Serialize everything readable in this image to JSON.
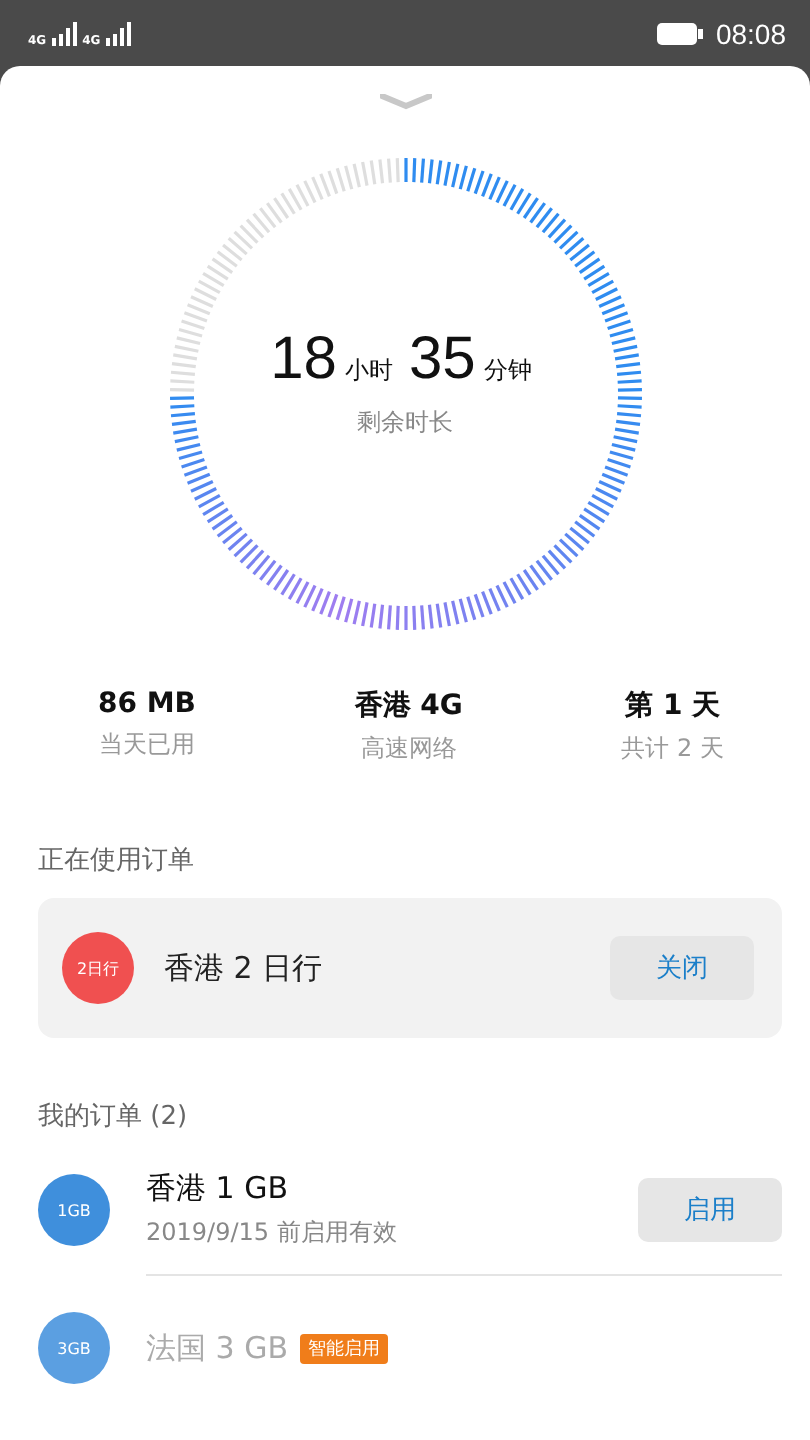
{
  "status_bar": {
    "signal_1": "4G",
    "signal_2": "4G",
    "time": "08:08"
  },
  "dial": {
    "hours": "18",
    "hours_unit": "小时",
    "minutes": "35",
    "minutes_unit": "分钟",
    "caption": "剩余时长"
  },
  "stats": [
    {
      "value": "86 MB",
      "label": "当天已用"
    },
    {
      "value": "香港 4G",
      "label": "高速网络"
    },
    {
      "value": "第 1 天",
      "label": "共计 2 天"
    }
  ],
  "active_section": {
    "title": "正在使用订单",
    "order": {
      "badge": "2日行",
      "name": "香港 2 日行",
      "button": "关闭"
    }
  },
  "orders_section": {
    "title": "我的订单 (2)",
    "orders": [
      {
        "badge": "1GB",
        "name": "香港 1 GB",
        "note": "2019/9/15 前启用有效",
        "button": "启用",
        "disabled": false
      },
      {
        "badge": "3GB",
        "name": "法国 3 GB",
        "tag": "智能启用",
        "disabled": true
      }
    ]
  }
}
